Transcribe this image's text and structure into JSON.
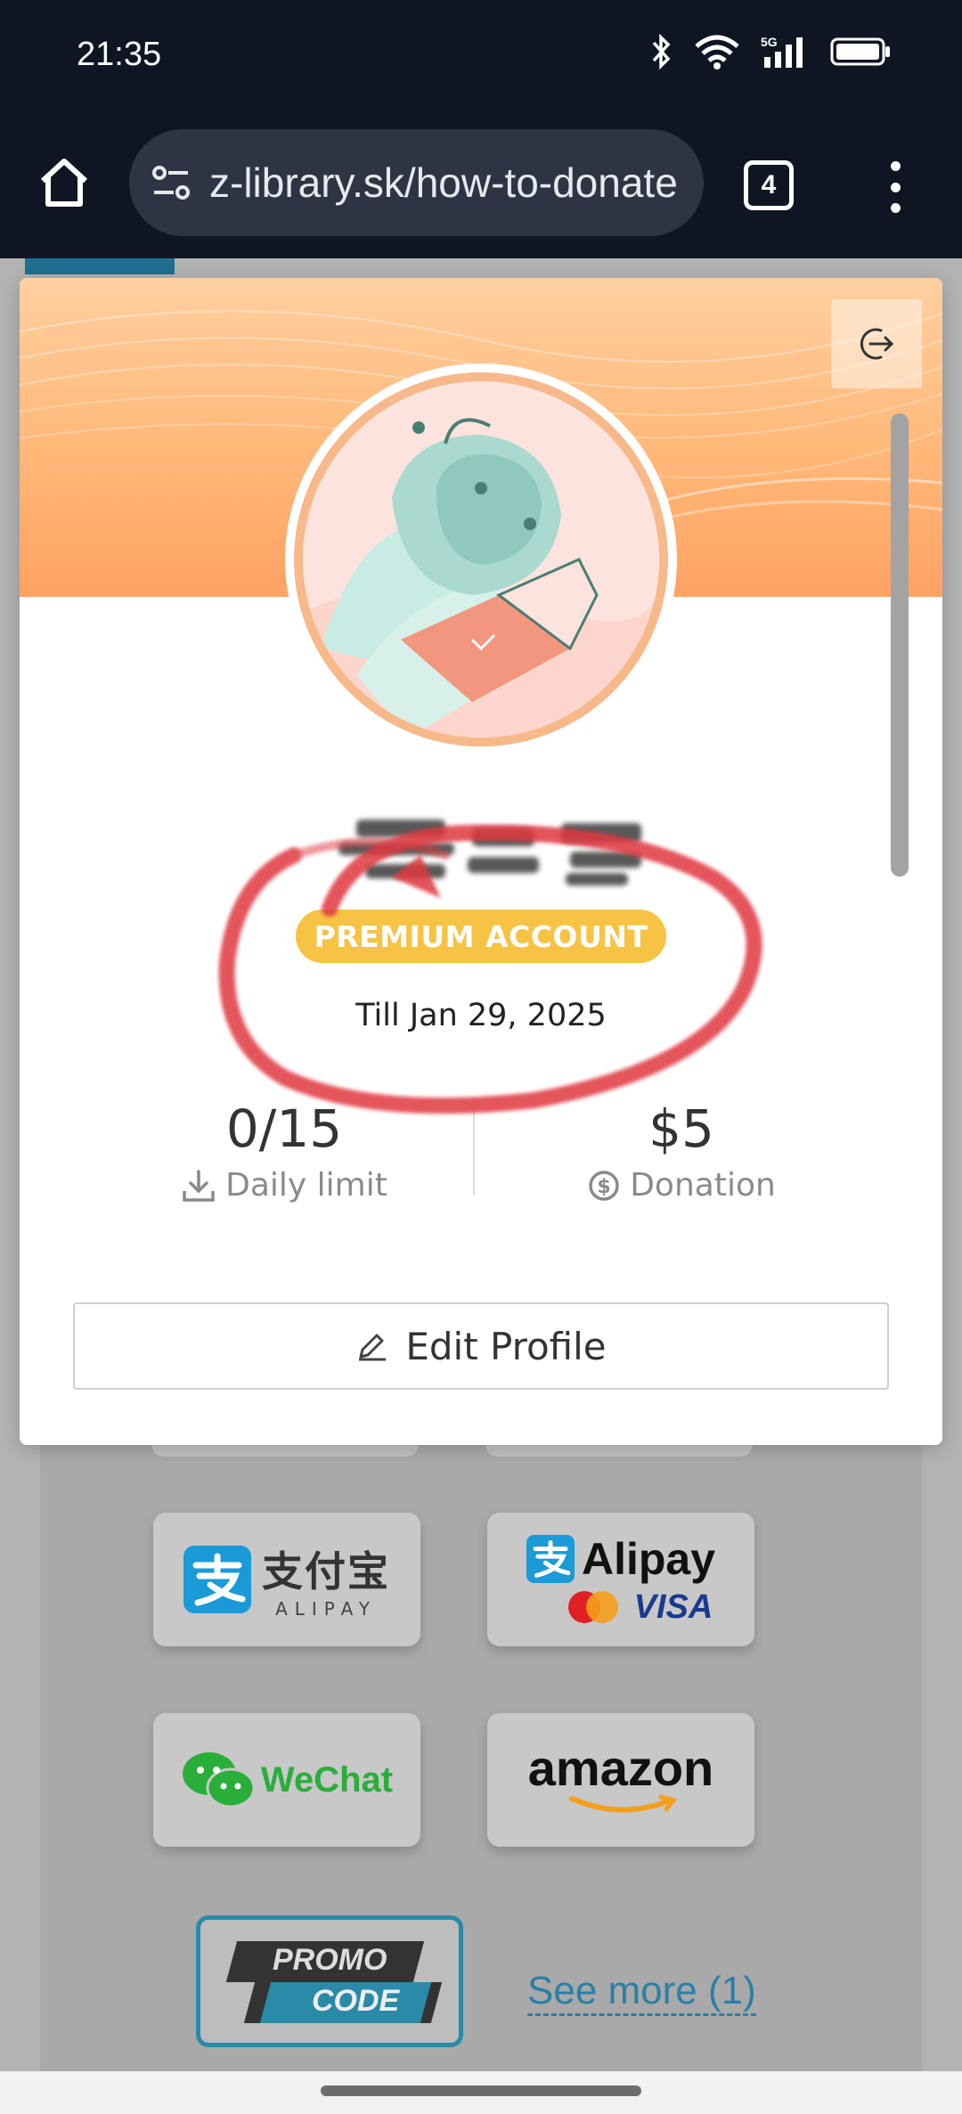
{
  "status_bar": {
    "time": "21:35",
    "network": "5G"
  },
  "browser": {
    "url": "z-library.sk/how-to-donate",
    "tab_count": "4"
  },
  "profile": {
    "badge": "PREMIUM ACCOUNT",
    "expiry": "Till Jan 29, 2025",
    "stats": {
      "daily_value": "0/15",
      "daily_label": "Daily limit",
      "donation_value": "$5",
      "donation_label": "Donation"
    },
    "edit_label": "Edit Profile"
  },
  "payments": {
    "alipay_cn": {
      "chars": "支付宝",
      "latin": "ALIPAY"
    },
    "alipay_intl": {
      "name": "Alipay",
      "visa": "VISA"
    },
    "wechat": "WeChat",
    "amazon": "amazon",
    "promo": {
      "line1": "PROMO",
      "line2": "CODE"
    },
    "see_more": "See more (1)"
  },
  "colors": {
    "annotation": "#e0393f",
    "badge": "#f7c344",
    "link": "#2a7fa5"
  }
}
